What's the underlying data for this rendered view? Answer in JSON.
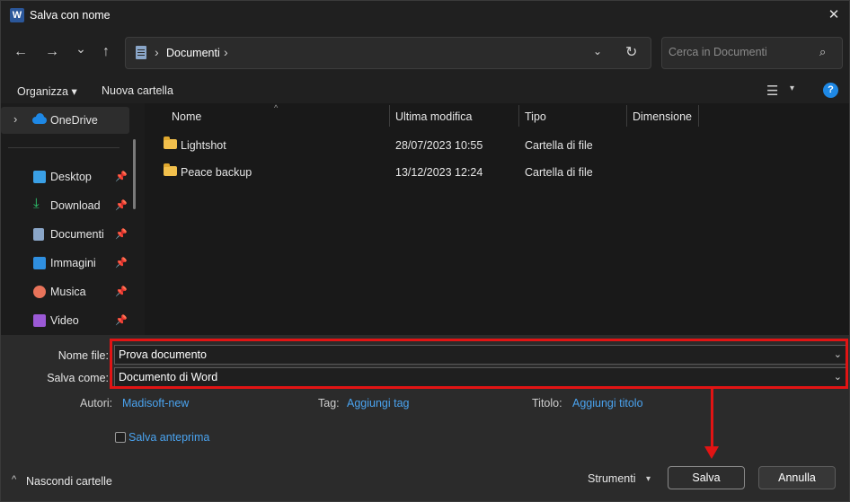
{
  "window": {
    "title": "Salva con nome",
    "app_icon_letter": "W",
    "close_glyph": "✕"
  },
  "nav": {
    "back_glyph": "←",
    "forward_glyph": "→",
    "recent_glyph": "⌄",
    "up_glyph": "↑",
    "address_text": "Documenti",
    "address_sep": "›",
    "dropdown_glyph": "⌄",
    "refresh_glyph": "↻",
    "search_placeholder": "Cerca in Documenti",
    "search_glyph": "⌕"
  },
  "toolbar": {
    "organize_label": "Organizza ▾",
    "new_folder_label": "Nuova cartella",
    "view_glyph": "☰",
    "view_caret": "▾",
    "help_glyph": "?"
  },
  "sidebar": {
    "onedrive": {
      "chevron": "›",
      "label": "OneDrive"
    },
    "items": [
      {
        "label": "Desktop",
        "icon": "desktop-icon",
        "color": "#3aa0e6"
      },
      {
        "label": "Download",
        "icon": "download-icon",
        "color": "#2ecc71"
      },
      {
        "label": "Documenti",
        "icon": "documents-icon",
        "color": "#8aa6c8"
      },
      {
        "label": "Immagini",
        "icon": "pictures-icon",
        "color": "#2f8fe0"
      },
      {
        "label": "Musica",
        "icon": "music-icon",
        "color": "#e8735a"
      },
      {
        "label": "Video",
        "icon": "video-icon",
        "color": "#9b59d6"
      }
    ],
    "pin_glyph": "📌"
  },
  "filelist": {
    "columns": [
      "Nome",
      "Ultima modifica",
      "Tipo",
      "Dimensione"
    ],
    "sort_glyph": "^",
    "rows": [
      {
        "name": "Lightshot",
        "modified": "28/07/2023 10:55",
        "type": "Cartella di file",
        "size": ""
      },
      {
        "name": "Peace backup",
        "modified": "13/12/2023 12:24",
        "type": "Cartella di file",
        "size": ""
      }
    ]
  },
  "form": {
    "filename_label": "Nome file:",
    "filename_value": "Prova documento",
    "savetype_label": "Salva come:",
    "savetype_value": "Documento di Word",
    "combo_caret": "⌄",
    "authors_label": "Autori:",
    "authors_value": "Madisoft-new",
    "tags_label": "Tag:",
    "tags_value": "Aggiungi tag",
    "title_label": "Titolo:",
    "title_value": "Aggiungi titolo",
    "preview_label": "Salva anteprima",
    "hide_folders_label": "Nascondi cartelle",
    "hide_chevron": "^",
    "tools_label": "Strumenti",
    "tools_caret": "▾",
    "save_button": "Salva",
    "cancel_button": "Annulla"
  },
  "colors": {
    "highlight": "#e11414",
    "link": "#4aa3ef",
    "folder": "#f2c04c"
  }
}
